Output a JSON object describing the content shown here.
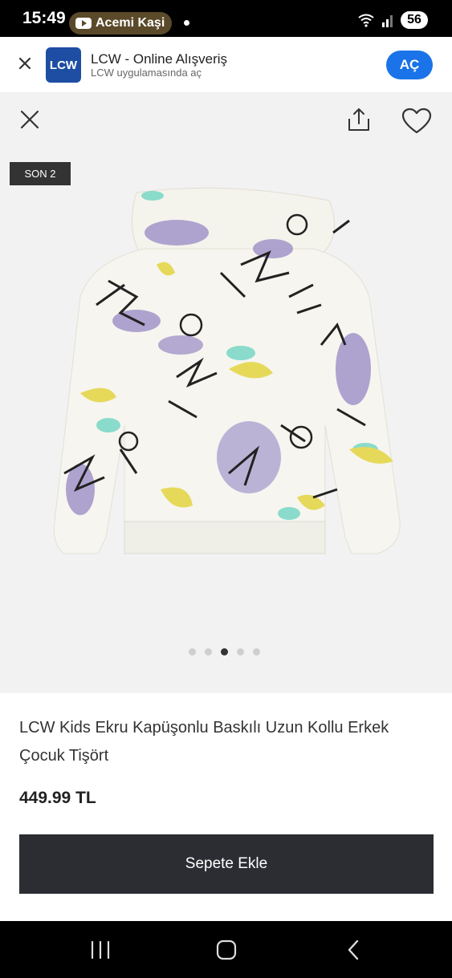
{
  "status_bar": {
    "time": "15:49",
    "notification_text": "Acemi Kaşi",
    "battery": "56",
    "icons": [
      "youtube-icon",
      "wifi-icon",
      "signal-icon",
      "battery-icon"
    ]
  },
  "app_banner": {
    "title": "LCW - Online Alışveriş",
    "subtitle": "LCW uygulamasında aç",
    "logo_text": "LCW",
    "open_label": "AÇ",
    "accent_color": "#1a73e8",
    "logo_color": "#1d4ea3"
  },
  "gallery": {
    "badge": "SON 2",
    "image_count": 5,
    "active_index": 2,
    "icons": [
      "close-icon",
      "share-icon",
      "heart-icon"
    ]
  },
  "product": {
    "title": "LCW Kids Ekru Kapüşonlu Baskılı Uzun Kollu Erkek Çocuk Tişört",
    "price": "449.99 TL",
    "add_to_cart_label": "Sepete Ekle",
    "button_color": "#2b2d33"
  },
  "nav_bar": {
    "icons": [
      "recents-icon",
      "home-icon",
      "back-icon"
    ]
  }
}
